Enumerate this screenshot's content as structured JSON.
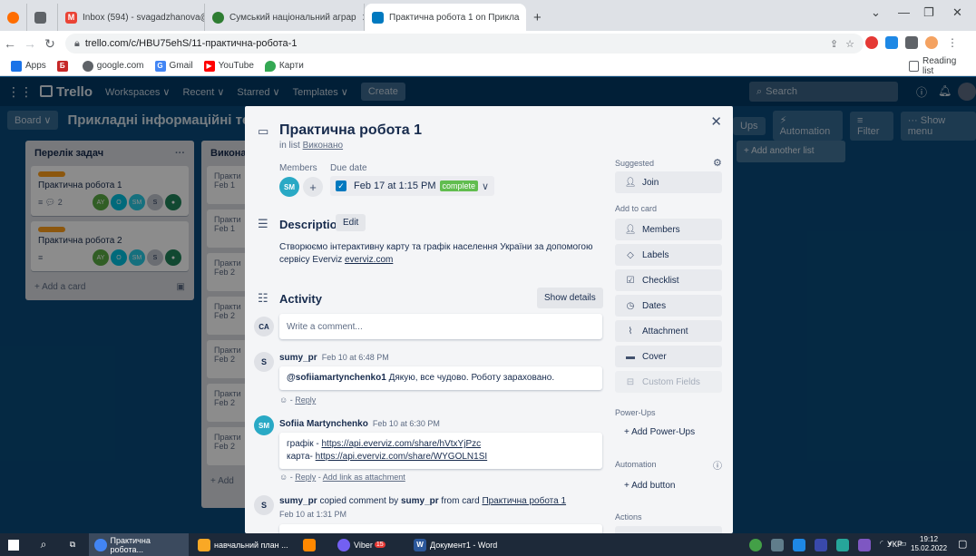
{
  "browser": {
    "tabs": [
      {
        "label": "",
        "active": false
      },
      {
        "label": "Inbox (594) - svagadzhanova@",
        "active": false
      },
      {
        "label": "Сумський національний аграр",
        "active": false
      },
      {
        "label": "Практична робота 1 on Прикла",
        "active": true
      }
    ],
    "new_tab": "+",
    "url": "trello.com/c/HBU75ehS/11-практична-робота-1",
    "bookmarks": [
      "Apps",
      "google.com",
      "Gmail",
      "YouTube",
      "Карти"
    ],
    "reading_list": "Reading list"
  },
  "trello": {
    "logo": "Trello",
    "nav": [
      "Workspaces ∨",
      "Recent ∨",
      "Starred ∨",
      "Templates ∨"
    ],
    "create": "Create",
    "search_placeholder": "Search",
    "board_btn": "Board ∨",
    "board_title": "Прикладні інформаційні техн",
    "right_buttons": [
      "Ups",
      "Automation",
      "Filter",
      "··· Show menu"
    ],
    "add_list": "+ Add another list"
  },
  "lists": {
    "list1": {
      "title": "Перелік задач",
      "more": "···",
      "cards": [
        {
          "title": "Практична робота 1",
          "badge": "2",
          "members": [
            "AY",
            "O",
            "SM",
            "S"
          ]
        },
        {
          "title": "Практична робота 2",
          "badge": "",
          "members": [
            "AY",
            "O",
            "SM",
            "S"
          ]
        }
      ],
      "add": "+ Add a card"
    },
    "list2": {
      "title": "Виконан",
      "cards": [
        "Практи",
        "Практи",
        "Практи",
        "Практи",
        "Практи",
        "Практи",
        "Практи"
      ],
      "dates": [
        "Feb 1",
        "Feb 1",
        "Feb 2",
        "Feb 2",
        "Feb 2",
        "Feb 2",
        "Feb 2"
      ],
      "add": "+ Add"
    }
  },
  "modal": {
    "title": "Практична робота 1",
    "in_list_prefix": "in list",
    "in_list": "Виконано",
    "members_label": "Members",
    "due_label": "Due date",
    "member_avatar": "SM",
    "add_member": "+",
    "due_value": "Feb 17 at 1:15 PM",
    "due_status": "complete",
    "description_h": "Description",
    "edit": "Edit",
    "description": "Створюємо інтерактивну карту та графік населення України за допомогою сервісу Everviz ",
    "description_link": "everviz.com",
    "activity_h": "Activity",
    "show_details": "Show details",
    "comment_avatar": "CA",
    "comment_placeholder": "Write a comment...",
    "comments": [
      {
        "avatar": "S",
        "author": "sumy_pr",
        "time": "Feb 10 at 6:48 PM",
        "mention": "@sofiiamartynchenko1",
        "text": " Дякую, все чудово. Роботу зараховано.",
        "reply": "Reply"
      },
      {
        "avatar": "SM",
        "author": "Sofiia Martynchenko",
        "time": "Feb 10 at 6:30 PM",
        "line1_prefix": "графік - ",
        "line1_link": "https://api.everviz.com/share/hVtxYjPzc",
        "line2_prefix": "карта- ",
        "line2_link": "https://api.everviz.com/share/WYGOLN1SI",
        "reply": "Reply",
        "attach": "Add link as attachment"
      },
      {
        "avatar": "S",
        "author": "sumy_pr",
        "action": " copied comment by ",
        "author2": "sumy_pr",
        "from": " from card ",
        "card_link": "Практична робота 1",
        "time": "Feb 10 at 1:31 PM"
      }
    ],
    "sidebar": {
      "suggested": "Suggested",
      "join": "Join",
      "add_to_card": "Add to card",
      "members": "Members",
      "labels": "Labels",
      "checklist": "Checklist",
      "dates": "Dates",
      "attachment": "Attachment",
      "cover": "Cover",
      "custom_fields": "Custom Fields",
      "powerups_h": "Power-Ups",
      "add_powerups": "+ Add Power-Ups",
      "automation_h": "Automation",
      "add_button": "+ Add button",
      "actions_h": "Actions"
    }
  },
  "taskbar": {
    "items": [
      "Практична робота...",
      "навчальний план ...",
      "Viber",
      "Документ1 - Word"
    ],
    "viber_badge": "15",
    "lang": "УКР",
    "time": "19:12",
    "date": "15.02.2022"
  },
  "colors": {
    "accent": "#0079bf",
    "trello_header": "#033a65",
    "label_orange": "#ff9f1a",
    "complete_green": "#61bd4f"
  }
}
